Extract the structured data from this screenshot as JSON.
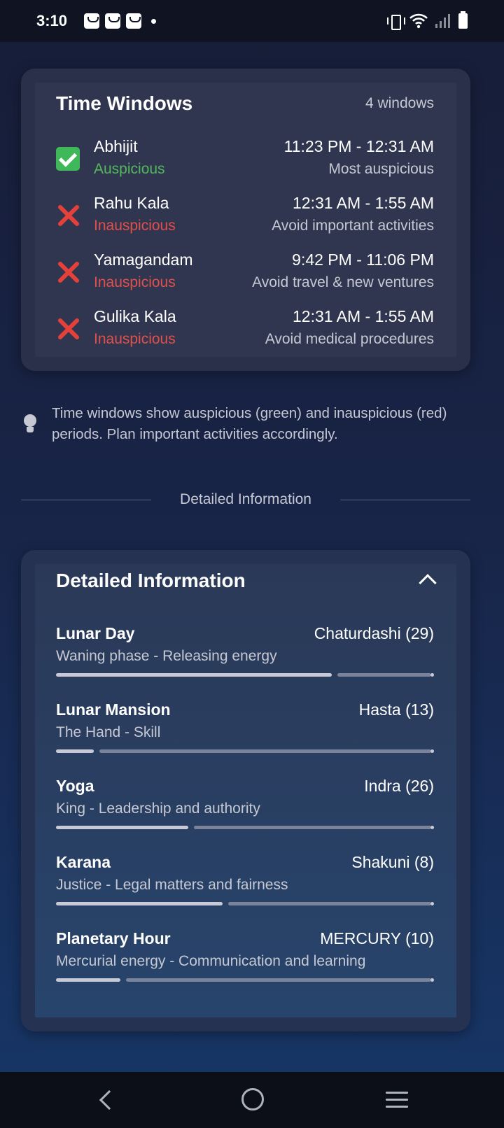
{
  "status_bar": {
    "time": "3:10",
    "notification_icons": [
      "shopping-bag-icon",
      "shopping-bag-icon",
      "shopping-bag-icon",
      "dot-icon"
    ],
    "system_icons": [
      "vibrate-icon",
      "wifi-icon",
      "signal-icon",
      "battery-icon"
    ]
  },
  "time_windows": {
    "title": "Time Windows",
    "count": "4 windows",
    "items": [
      {
        "name": "Abhijit",
        "status": "Auspicious",
        "kind": "good",
        "range": "11:23 PM - 12:31 AM",
        "note": "Most auspicious"
      },
      {
        "name": "Rahu Kala",
        "status": "Inauspicious",
        "kind": "bad",
        "range": "12:31 AM - 1:55 AM",
        "note": "Avoid important activities"
      },
      {
        "name": "Yamagandam",
        "status": "Inauspicious",
        "kind": "bad",
        "range": "9:42 PM - 11:06 PM",
        "note": "Avoid travel & new ventures"
      },
      {
        "name": "Gulika Kala",
        "status": "Inauspicious",
        "kind": "bad",
        "range": "12:31 AM - 1:55 AM",
        "note": "Avoid medical procedures"
      }
    ]
  },
  "tip": {
    "icon": "lightbulb-icon",
    "text": "Time windows show auspicious (green) and inauspicious (red) periods. Plan important activities accordingly."
  },
  "divider": {
    "label": "Detailed Information"
  },
  "detailed": {
    "title": "Detailed Information",
    "toggle_icon": "chevron-up-icon",
    "items": [
      {
        "label": "Lunar Day",
        "value": "Chaturdashi (29)",
        "desc": "Waning phase - Releasing energy",
        "progress": 0.73
      },
      {
        "label": "Lunar Mansion",
        "value": "Hasta (13)",
        "desc": "The Hand - Skill",
        "progress": 0.1
      },
      {
        "label": "Yoga",
        "value": "Indra (26)",
        "desc": "King - Leadership and authority",
        "progress": 0.35
      },
      {
        "label": "Karana",
        "value": "Shakuni (8)",
        "desc": "Justice - Legal matters and fairness",
        "progress": 0.44
      },
      {
        "label": "Planetary Hour",
        "value": "MERCURY (10)",
        "desc": "Mercurial energy - Communication and learning",
        "progress": 0.17
      }
    ]
  },
  "nav_bar": {
    "icons": [
      "back-icon",
      "home-icon",
      "recents-icon"
    ]
  }
}
